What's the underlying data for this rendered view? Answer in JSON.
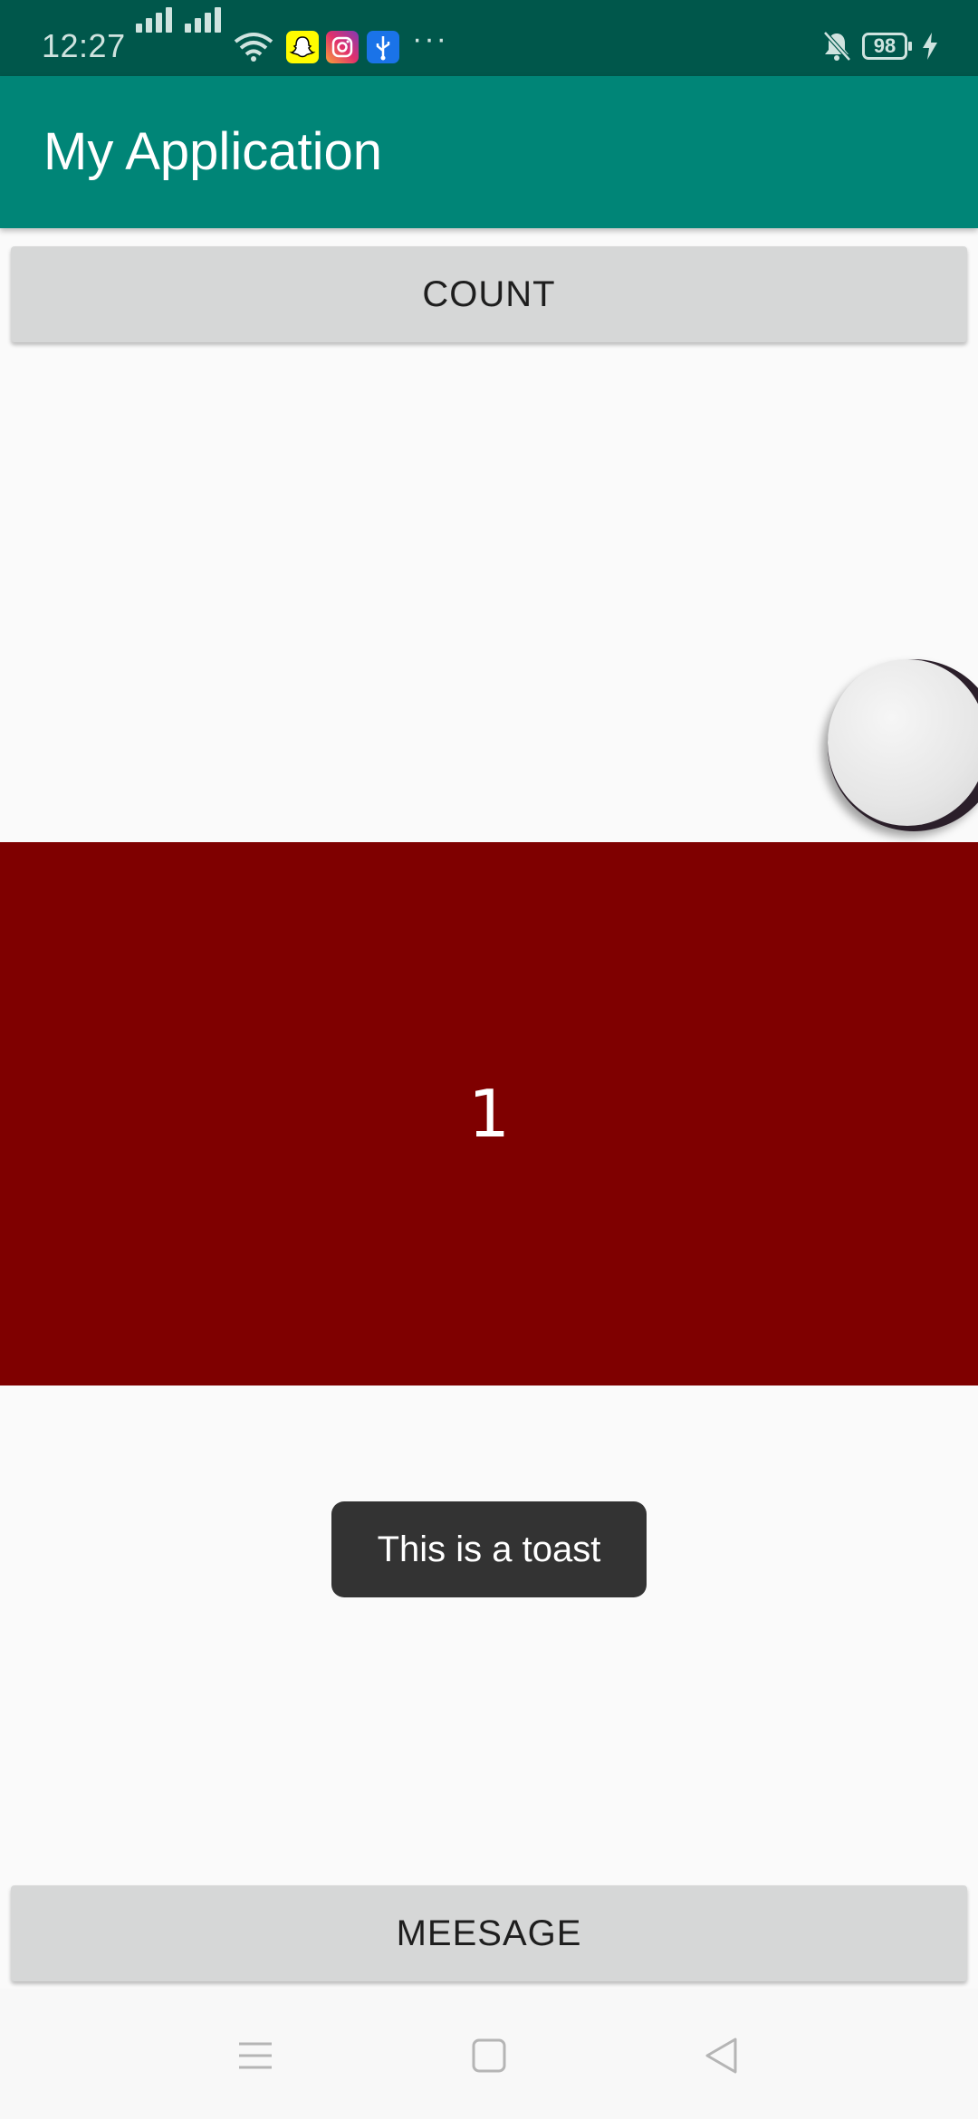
{
  "status_bar": {
    "time": "12:27",
    "notification_icons": [
      "snapchat-icon",
      "instagram-icon",
      "usb-icon"
    ],
    "more": "···",
    "battery_level": "98"
  },
  "app_bar": {
    "title": "My Application"
  },
  "buttons": {
    "count_label": "COUNT",
    "message_label": "MEESAGE"
  },
  "counter": {
    "value": "1",
    "background_color": "#7f0000"
  },
  "toast": {
    "text": "This is a toast"
  },
  "colors": {
    "primary": "#008577",
    "primary_dark": "#00574b",
    "button_bg": "#d6d7d7"
  },
  "nav_bar": {
    "icons": [
      "menu-icon",
      "home-icon",
      "back-icon"
    ]
  }
}
